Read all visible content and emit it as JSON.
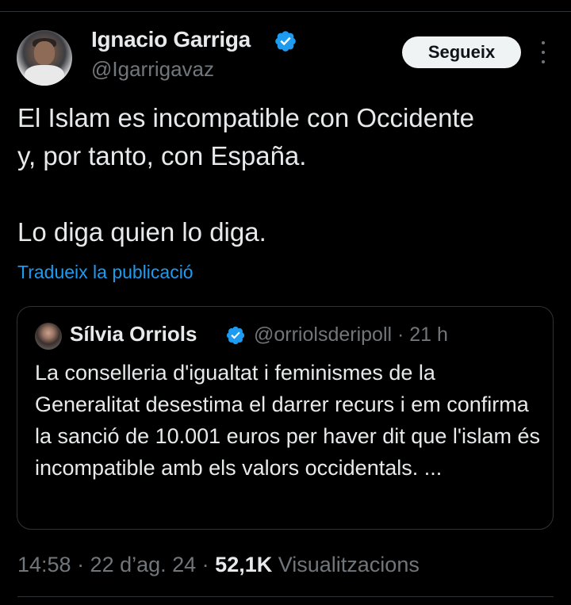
{
  "author": {
    "name": "Ignacio Garriga",
    "handle": "@Igarrigavaz",
    "verified_icon": "verified-badge-icon"
  },
  "actions": {
    "follow_label": "Segueix",
    "more_icon": "more-options-icon"
  },
  "tweet": {
    "text": "El Islam es incompatible con Occidente\ny, por tanto, con España.\n\nLo diga quien lo diga.",
    "translate_label": "Tradueix la publicació"
  },
  "quote": {
    "name": "Sílvia Orriols",
    "handle_time": "@orriolsderipoll · 21 h",
    "text": "La conselleria d'igualtat i feminismes de la Generalitat desestima el darrer recurs i em confirma la sanció de 10.001 euros per haver dit que l'islam és incompatible amb els valors occidentals. ..."
  },
  "meta": {
    "time_date": "14:58 · 22 d’ag. 24 · ",
    "views_count": "52,1K",
    "views_label": " Visualitzacions"
  },
  "colors": {
    "background": "#000000",
    "text": "#e7e9ea",
    "muted": "#71767b",
    "link": "#1d9bf0",
    "verified": "#1d9bf0"
  }
}
